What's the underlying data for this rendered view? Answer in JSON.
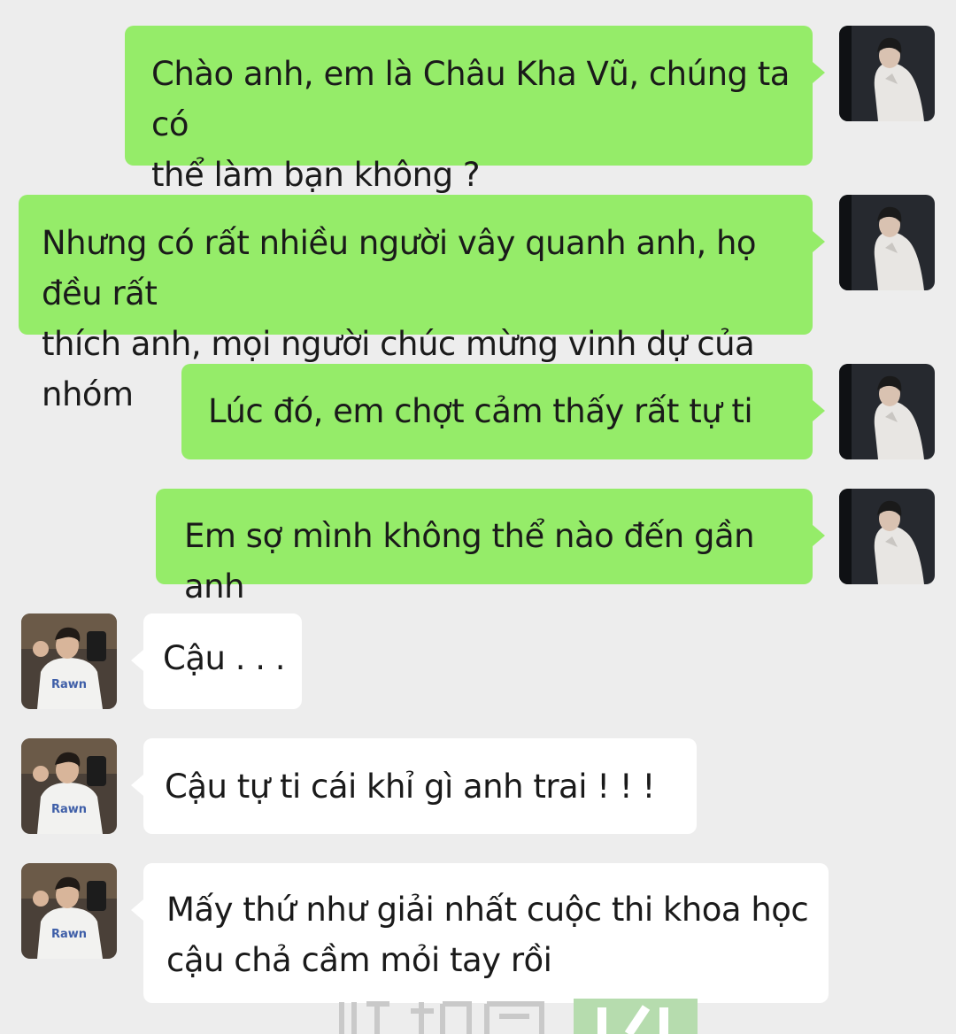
{
  "conversation": {
    "messages": [
      {
        "side": "out",
        "lines": [
          "Chào anh, em là Châu Kha Vũ, chúng ta có",
          "thể làm bạn không ?"
        ]
      },
      {
        "side": "out",
        "lines": [
          "Nhưng có rất nhiều người vây quanh anh, họ đều rất",
          "thích anh, mọi người chúc mừng vinh dự của nhóm"
        ]
      },
      {
        "side": "out",
        "lines": [
          "Lúc đó, em chợt cảm thấy rất tự ti"
        ]
      },
      {
        "side": "out",
        "lines": [
          "Em sợ mình không thể nào đến gần anh"
        ]
      },
      {
        "side": "in",
        "lines": [
          "Cậu . . ."
        ]
      },
      {
        "side": "in",
        "lines": [
          "Cậu tự ti cái khỉ gì anh trai ! ! !"
        ]
      },
      {
        "side": "in",
        "lines": [
          "Mấy thứ như giải nhất cuộc thi khoa học",
          "cậu chả cầm mỏi tay rồi"
        ]
      }
    ]
  },
  "colors": {
    "background": "#ededed",
    "outgoing_bubble": "#95ec69",
    "incoming_bubble": "#ffffff",
    "text": "#1a1a1a"
  },
  "icons": {
    "outgoing_avatar": "avatar-photo-white-shirt",
    "incoming_avatar": "avatar-photo-tshirt-selfie"
  }
}
